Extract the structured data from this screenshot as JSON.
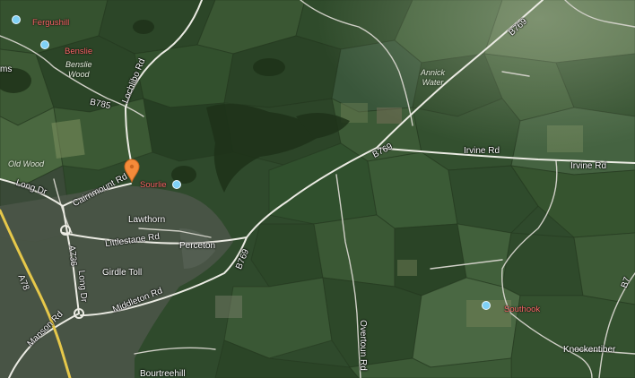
{
  "map": {
    "type": "satellite",
    "colors": {
      "field_dark": "#2e4a2b",
      "field_light": "#4f6d3e",
      "road": "#d8d8d0",
      "road_major": "#f0f0e8",
      "a_road": "#e6c84a",
      "poi_dot": "#7fd1f6",
      "poi_label": "#ff6b6b",
      "pin": "#f48b3a"
    }
  },
  "roads": {
    "lochlibo": "Lochlibo Rd",
    "b785": "B785",
    "b769_north": "B769",
    "b769_middle": "B769",
    "b769_south": "B769",
    "irvine_1": "Irvine Rd",
    "irvine_2": "Irvine Rd",
    "long_dr_1": "Long Dr",
    "long_dr_2": "Long Dr",
    "cairnmount": "Cairnmount Rd",
    "littlestane": "Littlestane Rd",
    "a736": "A736",
    "a78": "A78",
    "manson": "Manson Rd",
    "middleton": "Middleton Rd",
    "overtoun": "Overtoun Rd",
    "b7_edge": "B7"
  },
  "places": {
    "lawthorn": "Lawthorn",
    "perceton": "Perceton",
    "girdle_toll": "Girdle Toll",
    "knockentiber": "Knockentiber",
    "bourtreehill": "Bourtreehill",
    "ms_edge": "ms"
  },
  "areas": {
    "benslie_wood": "Benslie\nWood",
    "old_wood": "Old Wood",
    "annick_water": "Annick\nWater"
  },
  "pois": {
    "fergushill": "Fergushill",
    "benslie": "Benslie",
    "sourlie": "Sourlie",
    "southook": "Southook"
  }
}
